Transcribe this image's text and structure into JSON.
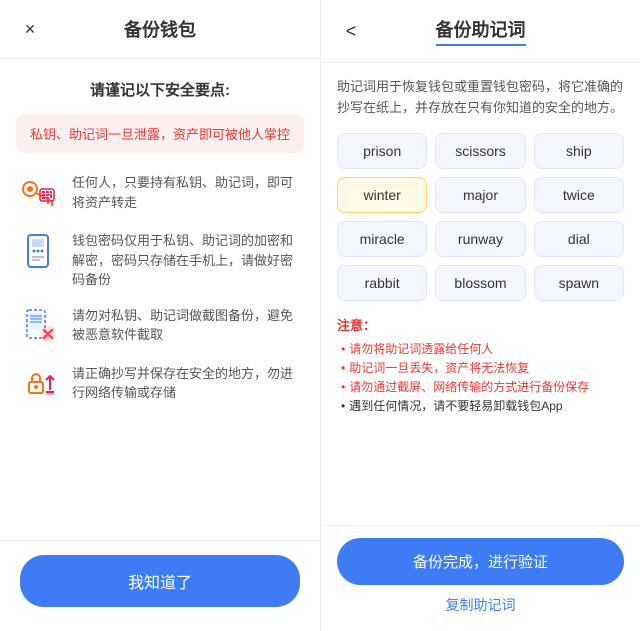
{
  "left": {
    "title": "备份钱包",
    "close_label": "×",
    "section_title": "请谨记以下安全要点:",
    "warning": "私钥、助记词一旦泄露，资产即可被他人掌控",
    "security_items": [
      {
        "text": "任何人，只要持有私钥、助记词，即可将资产转走",
        "icon": "key-calc-icon"
      },
      {
        "text": "钱包密码仅用于私钥、助记词的加密和解密，密码只存储在手机上，请做好密码备份",
        "icon": "phone-dots-icon"
      },
      {
        "text": "请勿对私钥、助记词做截图备份，避免被恶意软件截取",
        "icon": "scan-x-icon"
      },
      {
        "text": "请正确抄写并保存在安全的地方，勿进行网络传输或存储",
        "icon": "lock-upload-icon"
      }
    ],
    "confirm_button": "我知道了"
  },
  "right": {
    "title": "备份助记词",
    "back_label": "<",
    "description": "助记词用于恢复钱包或重置钱包密码，将它准确的抄写在纸上，并存放在只有你知道的安全的地方。",
    "words": [
      "prison",
      "scissors",
      "ship",
      "winter",
      "major",
      "twice",
      "miracle",
      "runway",
      "dial",
      "rabbit",
      "blossom",
      "spawn"
    ],
    "highlighted_word": "winter",
    "notice_title": "注意：",
    "notices": [
      {
        "text": "请勿将助记词透露给任何人",
        "dark": false
      },
      {
        "text": "助记词一旦丢失，资产将无法恢复",
        "dark": false
      },
      {
        "text": "请勿通过截屏、网络传输的方式进行备份保存",
        "dark": false
      },
      {
        "text": "遇到任何情况，请不要轻易卸载钱包App",
        "dark": true
      }
    ],
    "verify_button": "备份完成，进行验证",
    "copy_link": "复制助记词"
  }
}
